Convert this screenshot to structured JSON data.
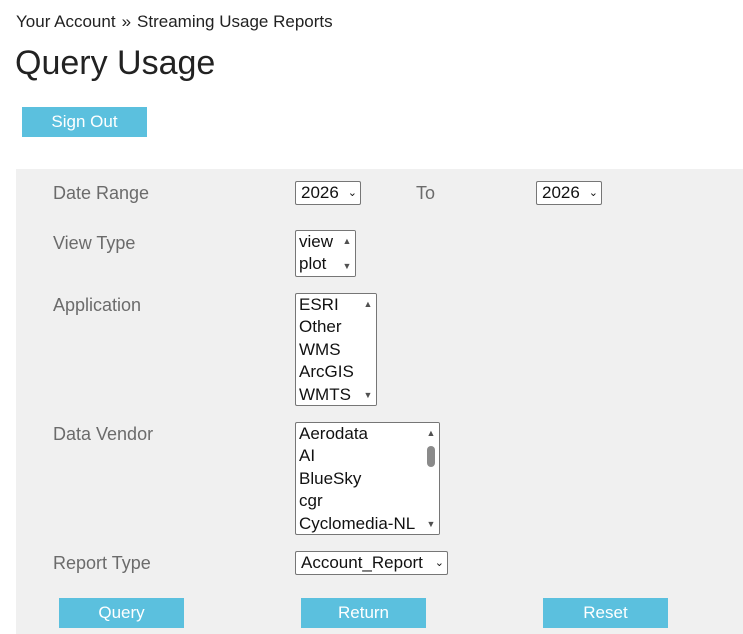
{
  "breadcrumb": {
    "account": "Your Account",
    "separator": "»",
    "current": "Streaming Usage Reports"
  },
  "page_title": "Query Usage",
  "sign_out_label": "Sign Out",
  "form": {
    "date_range": {
      "label": "Date Range",
      "from_value": "2026",
      "to_label": "To",
      "to_value": "2026"
    },
    "view_type": {
      "label": "View Type",
      "options": [
        "view",
        "plot"
      ]
    },
    "application": {
      "label": "Application",
      "options": [
        "ESRI",
        "Other",
        "WMS",
        "ArcGIS",
        "WMTS"
      ]
    },
    "data_vendor": {
      "label": "Data Vendor",
      "options": [
        "Aerodata",
        "AI",
        "BlueSky",
        "cgr",
        "Cyclomedia-NL"
      ]
    },
    "report_type": {
      "label": "Report Type",
      "value": "Account_Report"
    }
  },
  "buttons": {
    "query": "Query",
    "return": "Return",
    "reset": "Reset"
  },
  "colors": {
    "button_bg": "#5bc0de",
    "panel_bg": "#f0f0f0",
    "label_text": "#6b6b6b"
  },
  "icons": {
    "dropdown": "chevron-down-icon",
    "scroll_up": "triangle-up-icon",
    "scroll_down": "triangle-down-icon"
  }
}
